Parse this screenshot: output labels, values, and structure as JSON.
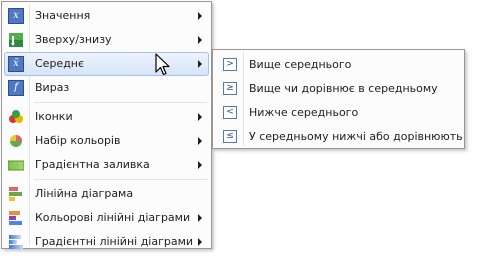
{
  "main_menu": {
    "items": [
      {
        "label": "Значення",
        "icon": "variable-x-icon",
        "submenu": true
      },
      {
        "label": "Зверху/знизу",
        "icon": "top-bottom-icon",
        "submenu": true
      },
      {
        "label": "Середнє",
        "icon": "average-x-bar-icon",
        "submenu": true,
        "highlighted": true
      },
      {
        "label": "Вираз",
        "icon": "expression-icon",
        "submenu": false
      },
      {
        "label": "Іконки",
        "icon": "icon-sets-icon",
        "submenu": true
      },
      {
        "label": "Набір кольорів",
        "icon": "color-scales-icon",
        "submenu": true
      },
      {
        "label": "Градієнтна заливка",
        "icon": "gradient-fill-icon",
        "submenu": true
      },
      {
        "label": "Лінійна діаграма",
        "icon": "data-bar-icon",
        "submenu": false
      },
      {
        "label": "Кольорові лінійні діаграми",
        "icon": "color-data-bars-icon",
        "submenu": true
      },
      {
        "label": "Градієнтні лінійні діаграми",
        "icon": "gradient-data-bars-icon",
        "submenu": true
      }
    ]
  },
  "submenu": {
    "items": [
      {
        "label": "Вище середнього",
        "symbol": ">",
        "icon": "greater-than-icon"
      },
      {
        "label": "Вище чи дорівнює в середньому",
        "symbol": "≥",
        "icon": "greater-or-equal-icon"
      },
      {
        "label": "Нижче середнього",
        "symbol": "<",
        "icon": "less-than-icon"
      },
      {
        "label": "У середньому нижчі або дорівнюють",
        "symbol": "≤",
        "icon": "less-or-equal-icon"
      }
    ]
  },
  "colors": {
    "highlight_border": "#a8c1e8",
    "highlight_fill": "#d6e4f9",
    "icon_blue": "#4f79c3"
  },
  "main_menu_glyphs": {
    "x": "x",
    "x_bar": "x̄",
    "f": "f"
  }
}
